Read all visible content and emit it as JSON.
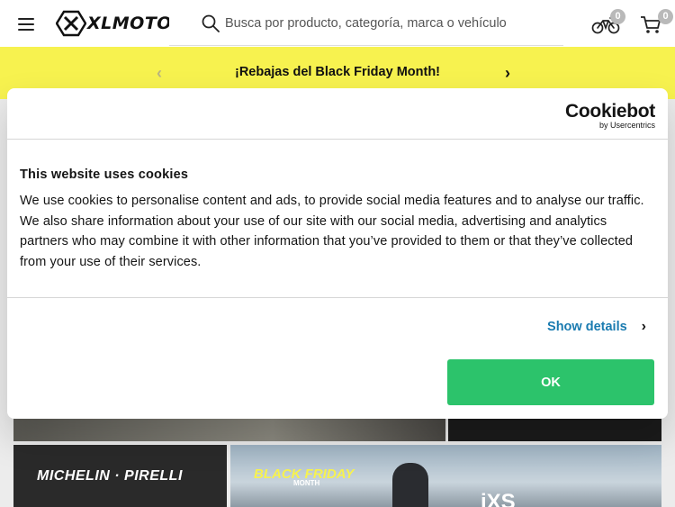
{
  "header": {
    "logo_text": "XLMOTO",
    "search_placeholder": "Busca por producto, categoría, marca o vehículo",
    "garage_count": "0",
    "cart_count": "0"
  },
  "promo": {
    "text": "¡Rebajas del Black Friday Month!",
    "prev": "‹",
    "next": "›"
  },
  "background": {
    "tile_left_text": "MICHELIN · PIRELLI",
    "tile_right_title": "BLACK FRIDAY",
    "tile_right_sub": "MONTH",
    "tile_right_brand": "iXS"
  },
  "cookie_dialog": {
    "brand": "Cookiebot",
    "brand_sub": "by Usercentrics",
    "title": "This website uses cookies",
    "body": "We use cookies to personalise content and ads, to provide social media features and to analyse our traffic. We also share information about your use of our site with our social media, advertising and analytics partners who may combine it with other information that you’ve provided to them or that they’ve collected from your use of their services.",
    "show_details_label": "Show details",
    "ok_label": "OK"
  },
  "colors": {
    "promo_yellow": "#f7f24f",
    "ok_green": "#2cc36b",
    "link_blue": "#1a7bb0"
  }
}
